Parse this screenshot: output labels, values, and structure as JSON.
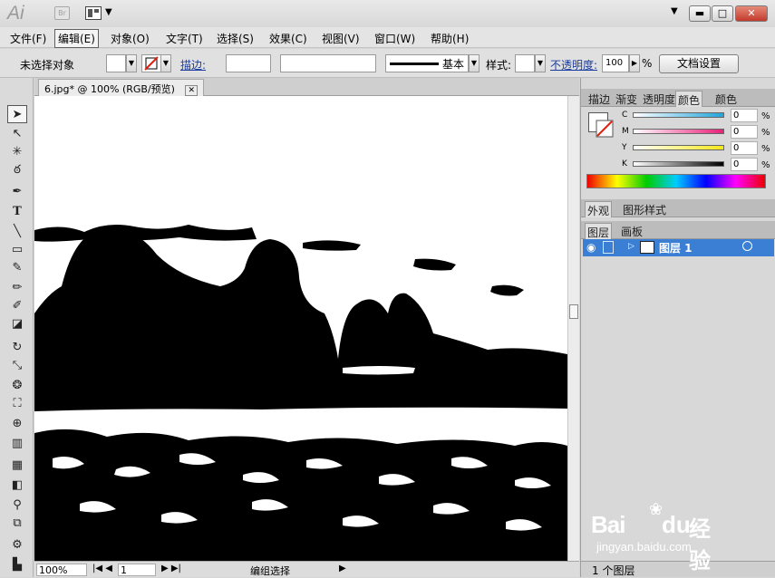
{
  "app": {
    "logo": "Ai",
    "bridge": "Br"
  },
  "menu": [
    "文件(F)",
    "编辑(E)",
    "对象(O)",
    "文字(T)",
    "选择(S)",
    "效果(C)",
    "视图(V)",
    "窗口(W)",
    "帮助(H)"
  ],
  "control": {
    "selection_status": "未选择对象",
    "stroke_label": "描边:",
    "stroke_style": "基本",
    "style_label": "样式:",
    "opacity_label": "不透明度:",
    "opacity_value": "100",
    "percent": "%",
    "doc_setup": "文档设置"
  },
  "document": {
    "tab_title": "6.jpg* @ 100% (RGB/预览)",
    "zoom": "100%",
    "artboard": "1",
    "status": "编组选择"
  },
  "color_panel": {
    "tabs": [
      "描边",
      "渐变",
      "透明度",
      "颜色",
      "颜色"
    ],
    "channels": [
      {
        "name": "C",
        "value": "0"
      },
      {
        "name": "M",
        "value": "0"
      },
      {
        "name": "Y",
        "value": "0"
      },
      {
        "name": "K",
        "value": "0"
      }
    ],
    "percent": "%"
  },
  "appearance_panel": {
    "tabs": [
      "外观",
      "图形样式"
    ]
  },
  "layers_panel": {
    "tabs": [
      "图层",
      "画板"
    ],
    "layer_name": "图层 1",
    "layer_count": "1 个图层"
  },
  "watermark": {
    "brand": "Bai",
    "brand2": "du",
    "text": "经验",
    "url": "jingyan.baidu.com"
  },
  "colors": {
    "accent": "#3b7fd4",
    "link": "#1a3c9e",
    "close": "#c43a2c"
  }
}
